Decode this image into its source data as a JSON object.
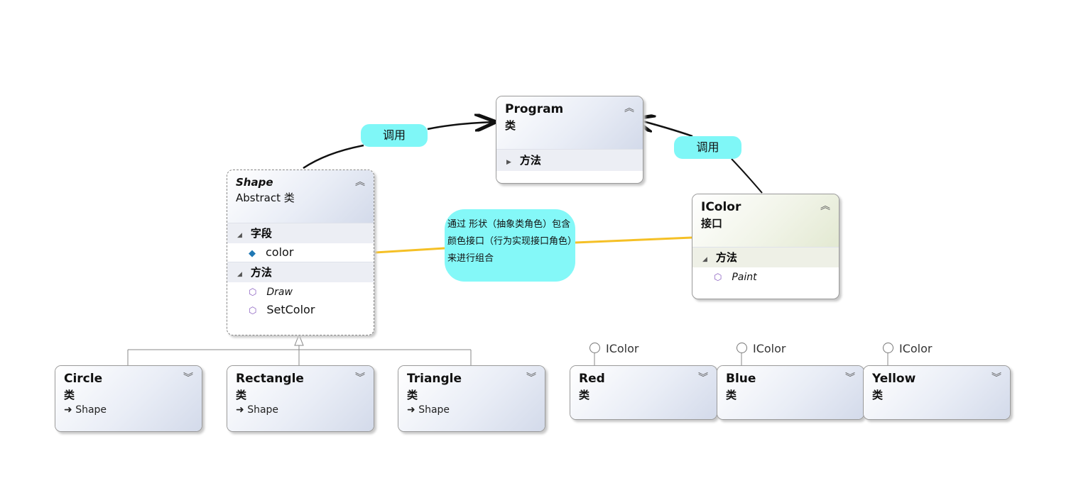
{
  "program": {
    "name": "Program",
    "kind": "类",
    "methods_section": "方法"
  },
  "shape": {
    "name": "Shape",
    "kind": "Abstract 类",
    "fields_section": "字段",
    "fields": [
      "color"
    ],
    "methods_section": "方法",
    "methods": [
      "Draw",
      "SetColor"
    ]
  },
  "icolor": {
    "name": "IColor",
    "kind": "接口",
    "methods_section": "方法",
    "methods": [
      "Paint"
    ]
  },
  "subclasses": [
    {
      "name": "Circle",
      "kind": "类",
      "base": "Shape"
    },
    {
      "name": "Rectangle",
      "kind": "类",
      "base": "Shape"
    },
    {
      "name": "Triangle",
      "kind": "类",
      "base": "Shape"
    }
  ],
  "colors": [
    {
      "name": "Red",
      "kind": "类",
      "interface": "IColor"
    },
    {
      "name": "Blue",
      "kind": "类",
      "interface": "IColor"
    },
    {
      "name": "Yellow",
      "kind": "类",
      "interface": "IColor"
    }
  ],
  "labels": {
    "call_left": "调用",
    "call_right": "调用"
  },
  "note": "通过 形状（抽象类角色）包含颜色接口（行为实现接口角色）来进行组合",
  "colors_accent": {
    "label_bg": "#7ff7f7",
    "association": "#f5c026",
    "line": "#111111"
  }
}
